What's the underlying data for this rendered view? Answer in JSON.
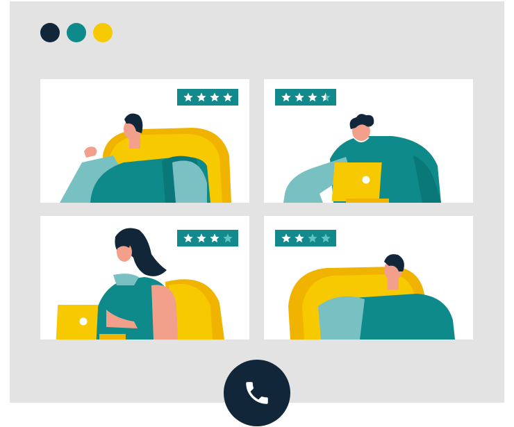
{
  "colors": {
    "window_bg": "#e3e3e3",
    "tile_bg": "#ffffff",
    "navy": "#12263a",
    "teal": "#0e8a8a",
    "yellow": "#f7c900",
    "star_on": "#ffffff",
    "star_off": "#5cc4c4",
    "rating_bg": "#12898a"
  },
  "window_controls": [
    {
      "name": "close",
      "color": "#12263a"
    },
    {
      "name": "minimize",
      "color": "#0e8a8a"
    },
    {
      "name": "maximize",
      "color": "#f7c900"
    }
  ],
  "participants": [
    {
      "id": "man-on-couch",
      "rating": 4,
      "max": 4
    },
    {
      "id": "man-with-laptop",
      "rating": 3.5,
      "max": 4
    },
    {
      "id": "woman-with-laptop",
      "rating": 3,
      "max": 4
    },
    {
      "id": "man-on-armchair",
      "rating": 2,
      "max": 4
    }
  ],
  "call_button": {
    "icon": "phone-icon",
    "color": "#12263a"
  }
}
